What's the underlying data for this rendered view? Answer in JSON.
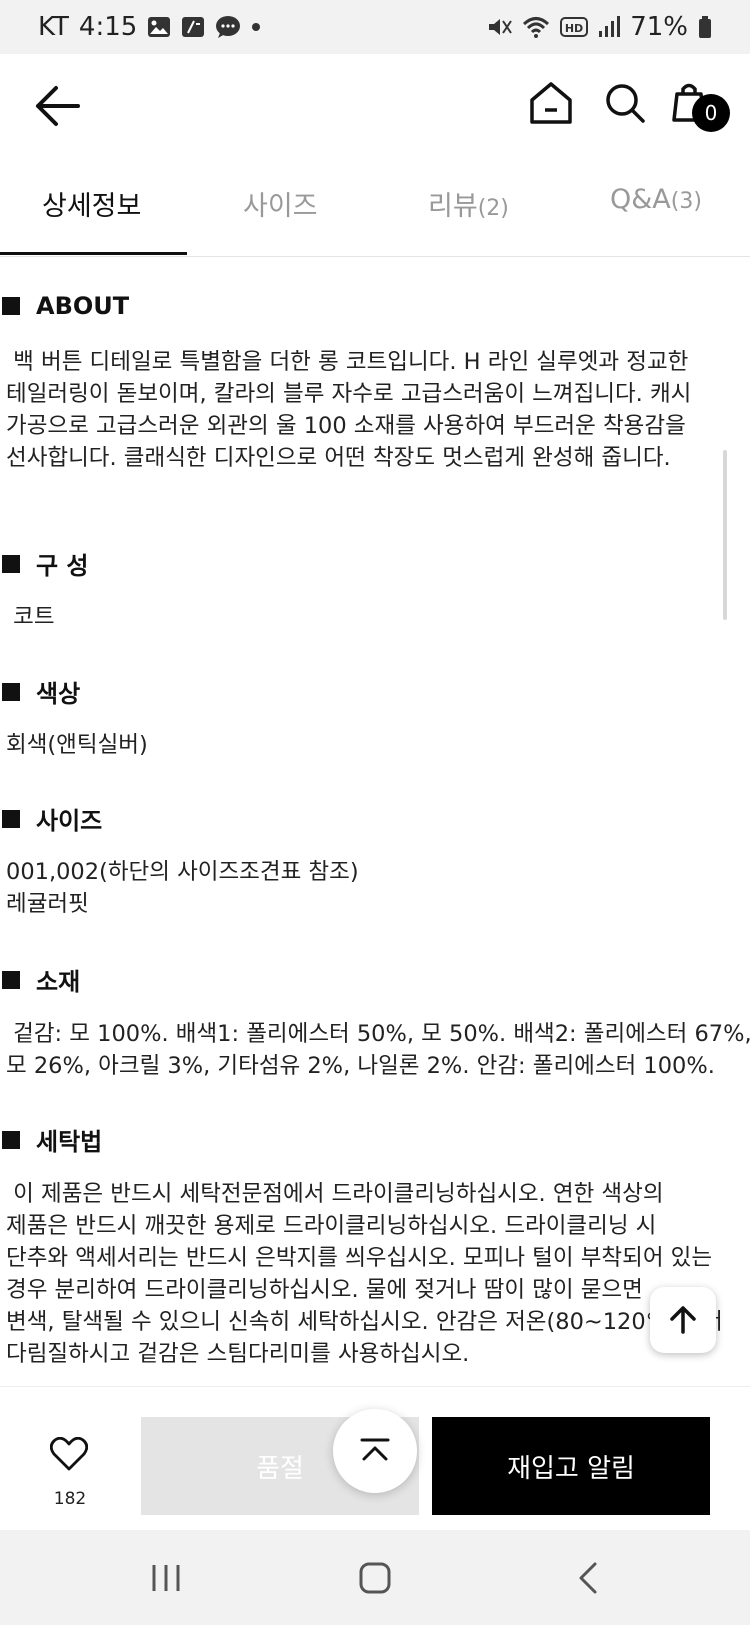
{
  "status_bar": {
    "carrier": "KT",
    "time": "4:15",
    "notif_icons": [
      "image-icon",
      "calendar-icon",
      "chat-icon",
      "dot-icon"
    ],
    "sys_icons": [
      "mute-icon",
      "wifi-icon",
      "hd-icon",
      "signal-icon"
    ],
    "battery": "71%"
  },
  "header": {
    "cart_count": "0"
  },
  "tabs": [
    {
      "label": "상세정보",
      "count": ""
    },
    {
      "label": "사이즈",
      "count": ""
    },
    {
      "label": "리뷰",
      "count": "(2)"
    },
    {
      "label": "Q&A",
      "count": "(3)"
    }
  ],
  "sections": {
    "about": {
      "title": "ABOUT",
      "lines": [
        " 백 버튼 디테일로 특별함을 더한 롱 코트입니다. H 라인 실루엣과 정교한",
        "테일러링이 돋보이며, 칼라의 블루 자수로 고급스러움이 느껴집니다. 캐시",
        "가공으로 고급스러운 외관의 울 100 소재를 사용하여 부드러운 착용감을",
        "선사합니다. 클래식한 디자인으로 어떤 착장도 멋스럽게 완성해 줍니다."
      ]
    },
    "composition": {
      "title": "구 성",
      "text": " 코트"
    },
    "color": {
      "title": "색상",
      "text": "회색(앤틱실버)"
    },
    "size": {
      "title": "사이즈",
      "lines": [
        "001,002(하단의 사이즈조견표 참조)",
        "레귤러핏"
      ]
    },
    "material": {
      "title": "소재",
      "lines": [
        " 겉감: 모 100%. 배색1: 폴리에스터 50%, 모 50%. 배색2: 폴리에스터 67%,",
        "모 26%, 아크릴 3%, 기타섬유 2%, 나일론 2%. 안감: 폴리에스터 100%."
      ]
    },
    "washing": {
      "title": "세탁법",
      "lines": [
        " 이 제품은 반드시 세탁전문점에서 드라이클리닝하십시오. 연한 색상의",
        "제품은 반드시 깨끗한 용제로 드라이클리닝하십시오. 드라이클리닝 시",
        "단추와 액세서리는 반드시 은박지를 씌우십시오. 모피나 털이 부착되어 있는",
        "경우 분리하여 드라이클리닝하십시오. 물에 젖거나 땀이 많이 묻으면",
        "변색, 탈색될 수 있으니 신속히 세탁하십시오. 안감은 저온(80~120°C)에서",
        "다림질하시고 겉감은 스팀다리미를 사용하십시오."
      ]
    }
  },
  "bottom": {
    "like_count": "182",
    "soldout_label": "품절",
    "restock_label": "재입고 알림"
  }
}
